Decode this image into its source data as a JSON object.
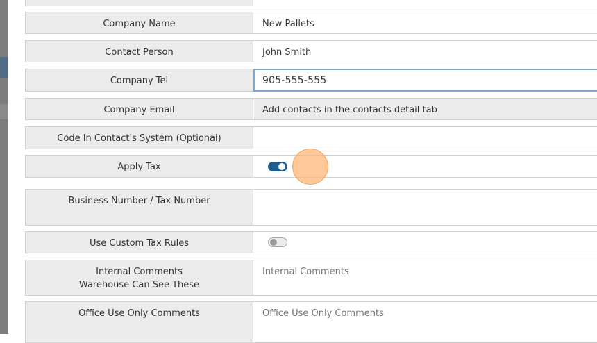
{
  "form": {
    "company_name": {
      "label": "Company Name",
      "value": "New Pallets"
    },
    "contact_person": {
      "label": "Contact Person",
      "value": "John Smith"
    },
    "company_tel": {
      "label": "Company Tel",
      "value": "905-555-555"
    },
    "company_email": {
      "label": "Company Email",
      "value": "Add contacts in the contacts detail tab"
    },
    "code_in_contacts_system": {
      "label": "Code In Contact's System (Optional)",
      "value": ""
    },
    "apply_tax": {
      "label": "Apply Tax",
      "enabled": true
    },
    "business_number": {
      "label": "Business Number / Tax Number",
      "value": ""
    },
    "use_custom_tax_rules": {
      "label": "Use Custom Tax Rules",
      "enabled": false
    },
    "internal_comments": {
      "label_line1": "Internal Comments",
      "label_line2": "Warehouse Can See These",
      "placeholder": "Internal Comments"
    },
    "office_use_only_comments": {
      "label": "Office Use Only Comments",
      "placeholder": "Office Use Only Comments"
    }
  },
  "colors": {
    "label_bg": "#ececec",
    "toggle_on": "#1f5f8f",
    "focus_border": "#7aa9d4",
    "click_indicator": "#ffb778"
  }
}
